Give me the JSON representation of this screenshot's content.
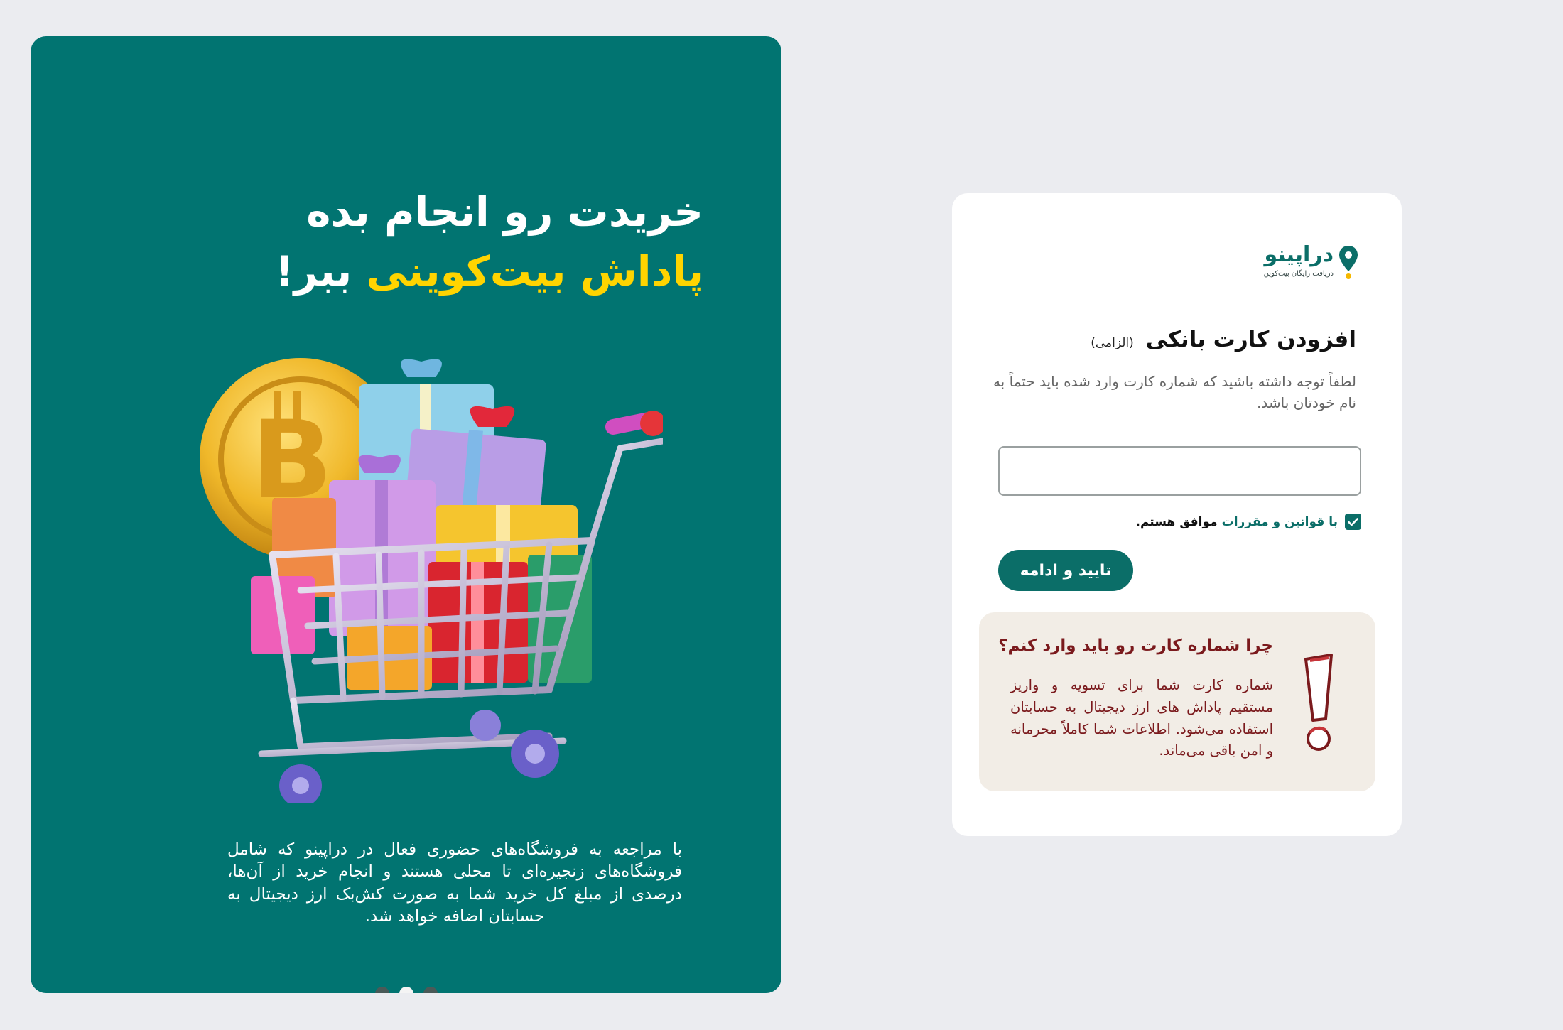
{
  "promo": {
    "title_line1": "خریدت رو انجام بده",
    "title_line2_accent": "پاداش بیت‌کوینی",
    "title_line2_rest": "ببر!",
    "description": "با مراجعه به فروشگاه‌های حضوری فعال در دراپینو که شامل فروشگاه‌های زنجیره‌ای تا محلی هستند و انجام خرید از آن‌ها، درصدی از مبلغ کل خرید شما به صورت کش‌بک ارز دیجیتال به حسابتان اضافه خواهد شد.",
    "slides": 3,
    "active_slide": 2
  },
  "brand": {
    "name": "دراپینو",
    "tagline": "دریافت رایگان بیت‌کوین",
    "primary_color": "#0b6e68",
    "accent_color": "#ffd400"
  },
  "form": {
    "title": "افزودن کارت بانکی",
    "required_tag": "(الزامی)",
    "hint": "لطفاً توجه داشته باشید که شماره کارت وارد شده باید حتماً به نام خودتان باشد.",
    "card_input_value": "",
    "agree_prefix": "با",
    "agree_link": "قوانین و مقررات",
    "agree_suffix": "موافق هستم.",
    "agree_checked": true,
    "submit_label": "تایید و ادامه"
  },
  "info": {
    "title": "چرا شماره کارت رو باید وارد کنم؟",
    "body": "شماره کارت شما برای تسویه و واریز مستقیم پاداش های ارز دیجیتال به حسابتان استفاده می‌شود. اطلاعات شما کاملاً محرمانه و امن باقی می‌ماند.",
    "icon": "exclamation-icon"
  }
}
